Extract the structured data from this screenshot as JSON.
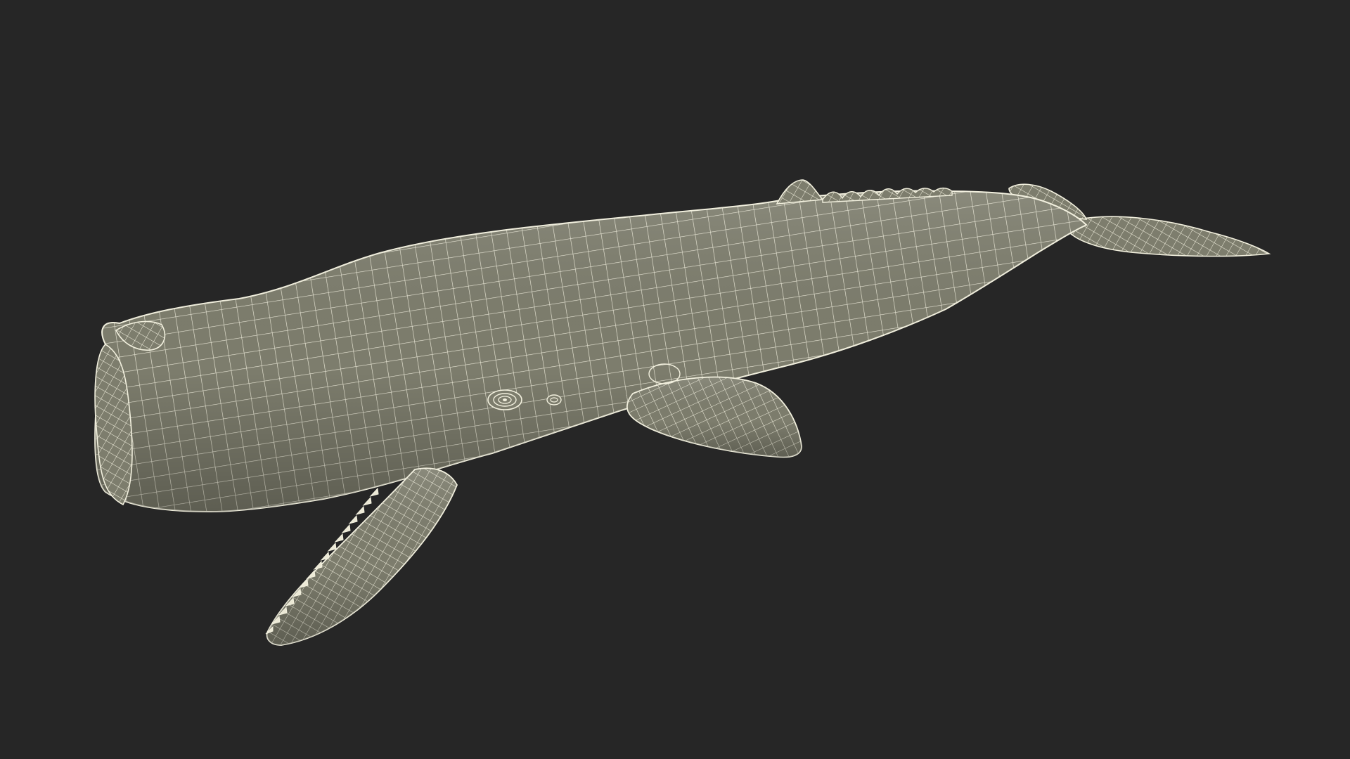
{
  "scene": {
    "subject": "sperm-whale-wireframe-model",
    "colors": {
      "background": "#262626",
      "surface": "#7d7d6d",
      "surface_light": "#8e8e7e",
      "surface_dark": "#66665a",
      "wire": "#f2f0de"
    },
    "parts": [
      "body",
      "lower-jaw",
      "teeth",
      "pectoral-fin",
      "dorsal-hump",
      "dorsal-ridges",
      "tail-stock",
      "tail-fluke",
      "eye",
      "ear"
    ]
  }
}
